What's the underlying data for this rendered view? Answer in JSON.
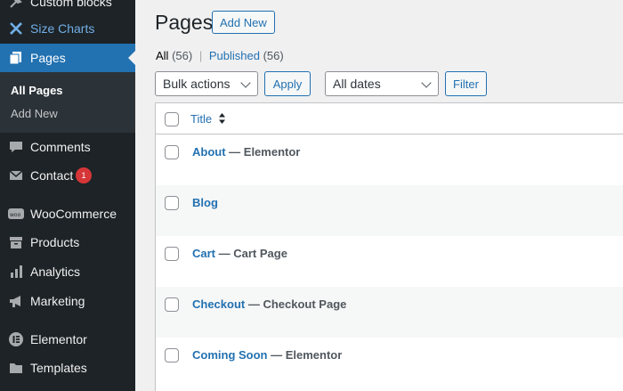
{
  "sidebar": {
    "items": [
      {
        "label": "Custom blocks",
        "icon": "pin-icon"
      },
      {
        "label": "Size Charts",
        "icon": "ruler-icon"
      },
      {
        "label": "Pages",
        "icon": "pages-icon"
      },
      {
        "label": "Comments",
        "icon": "comment-icon"
      },
      {
        "label": "Contact",
        "icon": "mail-icon",
        "badge": "1"
      },
      {
        "label": "WooCommerce",
        "icon": "woo-icon"
      },
      {
        "label": "Products",
        "icon": "archive-icon"
      },
      {
        "label": "Analytics",
        "icon": "bar-chart-icon"
      },
      {
        "label": "Marketing",
        "icon": "megaphone-icon"
      },
      {
        "label": "Elementor",
        "icon": "elementor-icon"
      },
      {
        "label": "Templates",
        "icon": "folder-icon"
      }
    ],
    "submenu": {
      "current": "All Pages",
      "other": "Add New"
    }
  },
  "header": {
    "title": "Pages",
    "add_new": "Add New"
  },
  "filters": {
    "all_label": "All",
    "all_count": "(56)",
    "separator": "|",
    "published_label": "Published",
    "published_count": "(56)"
  },
  "actions": {
    "bulk_selected": "Bulk actions",
    "apply": "Apply",
    "date_selected": "All dates",
    "filter": "Filter"
  },
  "table": {
    "column_title": "Title",
    "rows": [
      {
        "title": "About",
        "state": " — Elementor"
      },
      {
        "title": "Blog",
        "state": ""
      },
      {
        "title": "Cart",
        "state": " — Cart Page"
      },
      {
        "title": "Checkout",
        "state": " — Checkout Page"
      },
      {
        "title": "Coming Soon",
        "state": " — Elementor"
      }
    ]
  },
  "colors": {
    "sidebar_bg": "#1d2327",
    "accent": "#2271b1",
    "badge": "#d63638"
  }
}
